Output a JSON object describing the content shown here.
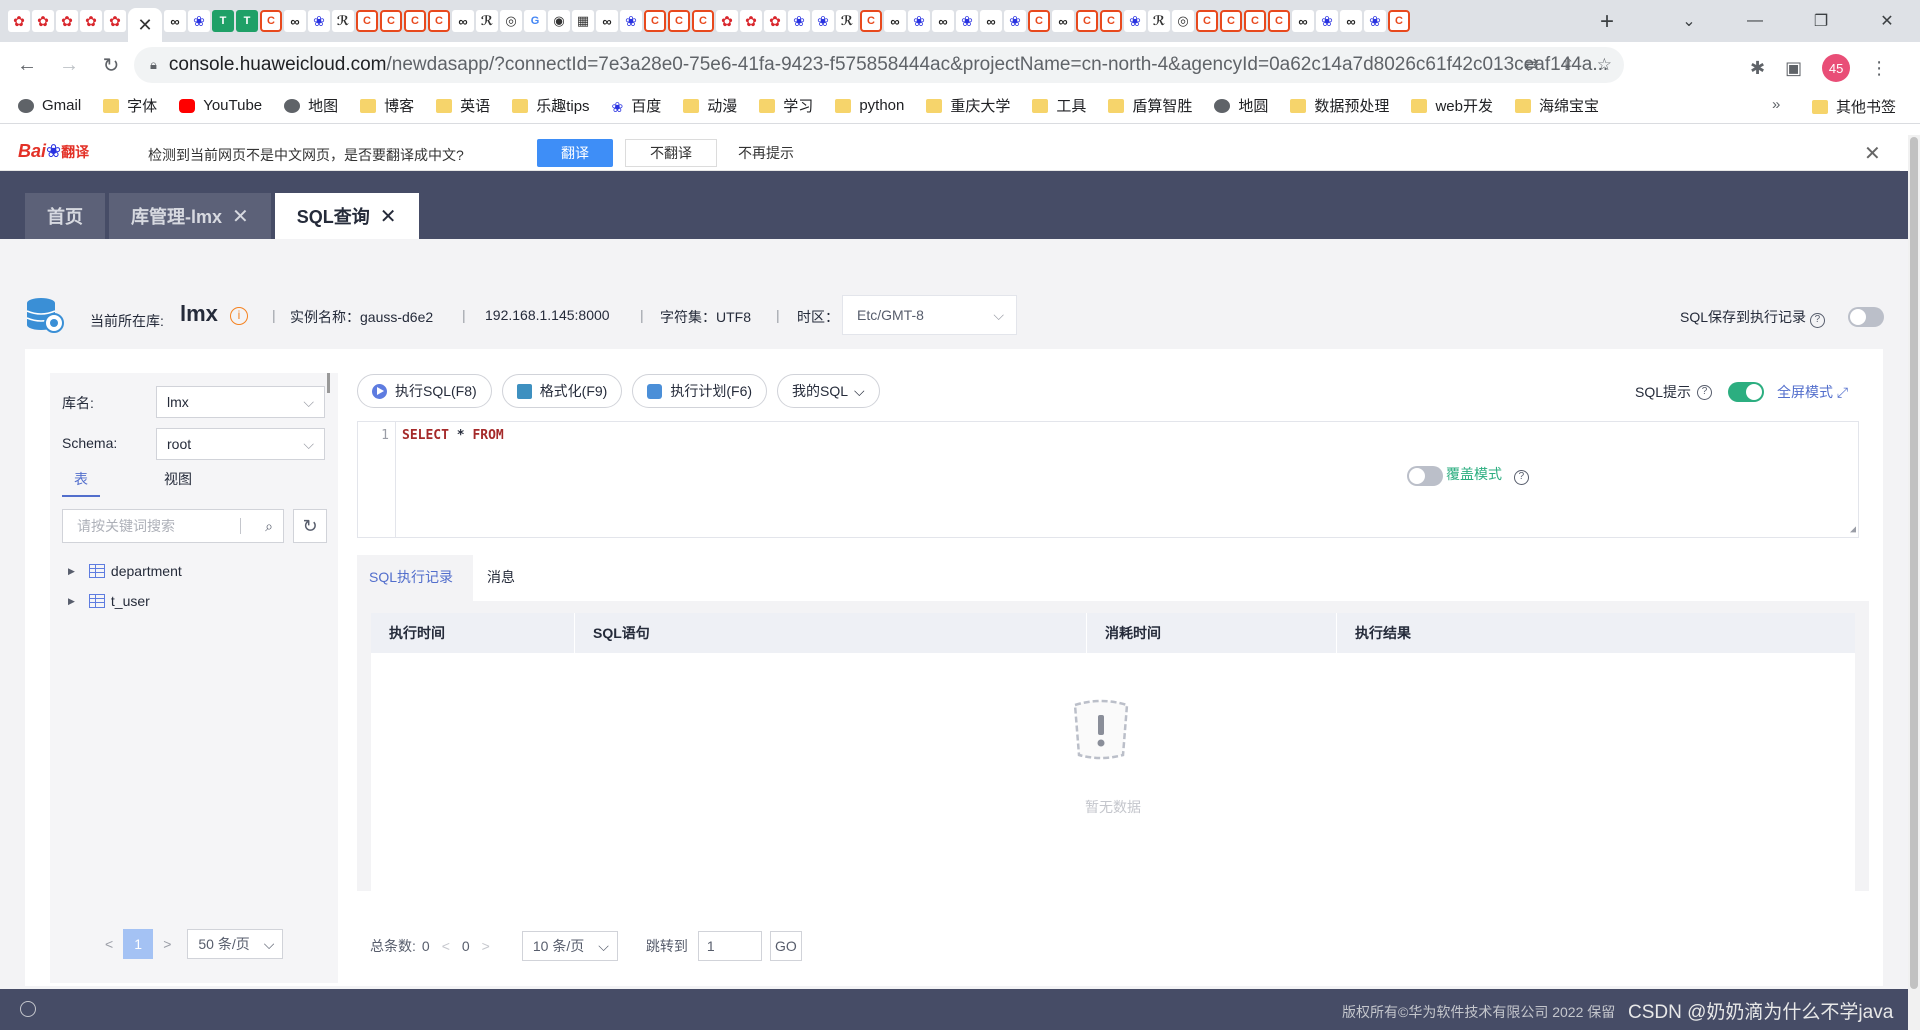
{
  "browser": {
    "url_host": "console.huaweicloud.com",
    "url_rest": "/newdasapp/?connectId=7e3a28e0-75e6-41fa-9423-f575858444ac&projectName=cn-north-4&agencyId=0a62c14a7d8026c61f42c013ceaf144a...",
    "profile_badge": "45",
    "bookmarks": [
      "Gmail",
      "字体",
      "YouTube",
      "地图",
      "博客",
      "英语",
      "乐趣tips",
      "百度",
      "动漫",
      "学习",
      "python",
      "重庆大学",
      "工具",
      "盾算智胜",
      "地圆",
      "数据预处理",
      "web开发",
      "海绵宝宝"
    ],
    "other_bookmarks": "其他书签",
    "more": "»"
  },
  "translate_bar": {
    "logo": "Bai",
    "logo_suffix": "翻译",
    "message": "检测到当前网页不是中文网页，是否要翻译成中文?",
    "translate_btn": "翻译",
    "no_translate_btn": "不翻译",
    "never_btn": "不再提示"
  },
  "app_tabs": [
    {
      "label": "首页"
    },
    {
      "label": "库管理-lmx"
    },
    {
      "label": "SQL查询"
    }
  ],
  "db_info": {
    "current_db_label": "当前所在库:",
    "current_db": "lmx",
    "instance": "实例名称：gauss-d6e2",
    "address": "192.168.1.145:8000",
    "charset": "字符集：UTF8",
    "timezone_label": "时区：",
    "timezone": "Etc/GMT-8",
    "save_to_history": "SQL保存到执行记录"
  },
  "left_panel": {
    "db_label": "库名:",
    "db_value": "lmx",
    "schema_label": "Schema:",
    "schema_value": "root",
    "tabs": [
      "表",
      "视图"
    ],
    "search_placeholder": "请按关键词搜索",
    "tables": [
      "department",
      "t_user"
    ],
    "pager": {
      "prev": "<",
      "page": "1",
      "next": ">",
      "size": "50 条/页"
    }
  },
  "editor": {
    "buttons": [
      "执行SQL(F8)",
      "格式化(F9)",
      "执行计划(F6)",
      "我的SQL"
    ],
    "sql_hint": "SQL提示",
    "fullscreen": "全屏模式",
    "line_number": "1",
    "code_select": "SELECT",
    "code_op": "*",
    "code_from": "FROM"
  },
  "results": {
    "tabs": [
      "SQL执行记录",
      "消息"
    ],
    "cover_mode": "覆盖模式",
    "columns": [
      "执行时间",
      "SQL语句",
      "消耗时间",
      "执行结果"
    ],
    "empty_text": "暂无数据",
    "pager": {
      "total_label": "总条数:",
      "total": "0",
      "prev": "<",
      "page": "0",
      "next": ">",
      "size": "10 条/页",
      "jump_label": "跳转到",
      "jump_value": "1",
      "go": "GO"
    }
  },
  "footer": {
    "copyright": "版权所有©华为软件技术有限公司 2022 保留",
    "watermark": "CSDN @奶奶滴为什么不学java"
  },
  "colors": {
    "header_bg": "#464c66",
    "accent": "#526ecc",
    "toggle_on": "#2cae80",
    "translate_blue": "#3e8ef7"
  }
}
